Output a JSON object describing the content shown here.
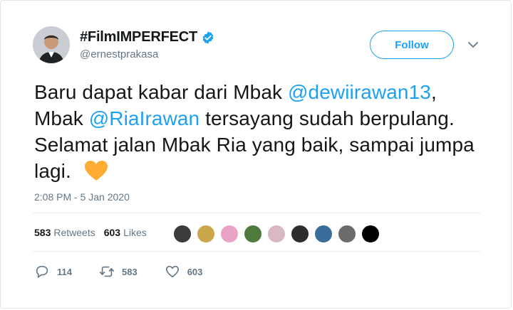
{
  "author": {
    "display_name": "#FilmIMPERFECT",
    "handle": "@ernestprakasa",
    "verified": true
  },
  "follow_label": "Follow",
  "tweet": {
    "segments": [
      {
        "text": "Baru dapat kabar dari Mbak ",
        "type": "text"
      },
      {
        "text": "@dewiirawan13",
        "type": "mention"
      },
      {
        "text": ", Mbak ",
        "type": "text"
      },
      {
        "text": "@RiaIrawan",
        "type": "mention"
      },
      {
        "text": " tersayang sudah berpulang. Selamat jalan Mbak Ria yang baik, sampai jumpa lagi. ",
        "type": "text"
      }
    ],
    "emoji": "orange-heart",
    "timestamp": "2:08 PM - 5 Jan 2020"
  },
  "stats": {
    "retweets_count": "583",
    "retweets_label": "Retweets",
    "likes_count": "603",
    "likes_label": "Likes"
  },
  "likers": [
    {
      "name": "liker-1",
      "color": "#3b3b3b"
    },
    {
      "name": "liker-2",
      "color": "#c9a74a"
    },
    {
      "name": "liker-3",
      "color": "#e8a3c7"
    },
    {
      "name": "liker-4",
      "color": "#4f7a3e"
    },
    {
      "name": "liker-5",
      "color": "#d8b8c4"
    },
    {
      "name": "liker-6",
      "color": "#2e2e2e"
    },
    {
      "name": "liker-7",
      "color": "#3a6e9a"
    },
    {
      "name": "liker-8",
      "color": "#6b6b6b"
    },
    {
      "name": "liker-9",
      "color": "#000000"
    }
  ],
  "actions": {
    "reply_count": "114",
    "retweet_count": "583",
    "like_count": "603"
  },
  "colors": {
    "accent": "#1da1f2",
    "muted": "#657786",
    "text": "#14171a",
    "heart": "#ffac33"
  }
}
